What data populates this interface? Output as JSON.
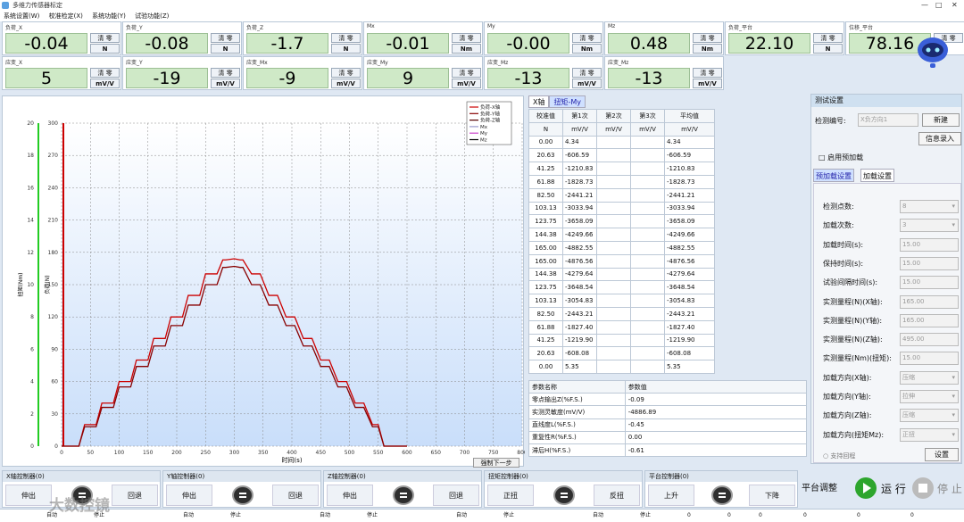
{
  "window": {
    "title": "多维力传感器标定",
    "controls": [
      "—",
      "□",
      "✕"
    ]
  },
  "menu": [
    "系统设置(W)",
    "校准检定(X)",
    "系统功能(Y)",
    "试验功能(Z)"
  ],
  "tiles": [
    {
      "label": "负荷_X",
      "value": "-0.04",
      "clear": "清 零",
      "unit": "N"
    },
    {
      "label": "负荷_Y",
      "value": "-0.08",
      "clear": "清 零",
      "unit": "N"
    },
    {
      "label": "负荷_Z",
      "value": "-1.7",
      "clear": "清 零",
      "unit": "N"
    },
    {
      "label": "Mx",
      "value": "-0.01",
      "clear": "清 零",
      "unit": "Nm"
    },
    {
      "label": "My",
      "value": "-0.00",
      "clear": "清 零",
      "unit": "Nm"
    },
    {
      "label": "Mz",
      "value": "0.48",
      "clear": "清 零",
      "unit": "Nm"
    },
    {
      "label": "负荷_平台",
      "value": "22.10",
      "clear": "清 零",
      "unit": "N"
    },
    {
      "label": "位移_平台",
      "value": "78.16",
      "clear": "清 零",
      "unit": ""
    },
    {
      "label": "应变_X",
      "value": "5",
      "clear": "清 零",
      "unit": "mV/V"
    },
    {
      "label": "应变_Y",
      "value": "-19",
      "clear": "清 零",
      "unit": "mV/V"
    },
    {
      "label": "应变_Mx",
      "value": "-9",
      "clear": "清 零",
      "unit": "mV/V"
    },
    {
      "label": "应变_My",
      "value": "9",
      "clear": "清 零",
      "unit": "mV/V"
    },
    {
      "label": "应变_Mz",
      "value": "-13",
      "clear": "清 零",
      "unit": "mV/V"
    },
    {
      "label": "应变_Mz",
      "value": "-13",
      "clear": "清 零",
      "unit": "mV/V"
    }
  ],
  "chart_data": {
    "type": "line",
    "xlabel": "时间(s)",
    "ylabel": "负荷(N)",
    "y2label": "扭矩(Nm)",
    "xlim": [
      0,
      800
    ],
    "ylim": [
      0,
      300
    ],
    "y2lim": [
      0,
      20
    ],
    "x_ticks": [
      "0",
      "50",
      "100",
      "150",
      "200",
      "250",
      "300",
      "350",
      "400",
      "450",
      "500",
      "550",
      "600",
      "650",
      "700",
      "750",
      "800"
    ],
    "y_ticks": [
      "0",
      "30",
      "60",
      "90",
      "120",
      "150",
      "180",
      "210",
      "240",
      "270",
      "300"
    ],
    "y2_ticks": [
      "0",
      "2",
      "4",
      "6",
      "8",
      "10",
      "12",
      "14",
      "16",
      "18",
      "20"
    ],
    "legend": [
      "负荷-X轴",
      "负荷-Y轴",
      "负荷-Z轴",
      "Mx",
      "My",
      "Mz"
    ],
    "legend_colors": [
      "#cc0000",
      "#880000",
      "#550000",
      "#9999cc",
      "#cc44cc",
      "#000000"
    ],
    "series": [
      {
        "name": "负荷-X轴",
        "color": "#cc0000",
        "x": [
          0,
          30,
          40,
          45,
          60,
          70,
          75,
          90,
          100,
          105,
          120,
          130,
          135,
          150,
          160,
          165,
          180,
          190,
          195,
          210,
          220,
          225,
          240,
          250,
          255,
          270,
          280,
          285,
          300,
          310,
          315,
          330,
          340,
          345,
          360,
          370,
          375,
          390,
          400,
          405,
          420,
          430,
          435,
          450,
          460,
          465,
          480,
          490,
          495,
          510,
          520,
          525,
          540,
          550,
          560,
          600
        ],
        "y": [
          0,
          0,
          20,
          20,
          20,
          40,
          40,
          40,
          60,
          60,
          60,
          80,
          80,
          80,
          100,
          100,
          100,
          120,
          120,
          120,
          140,
          140,
          140,
          160,
          160,
          160,
          173,
          173,
          174,
          173,
          173,
          160,
          160,
          160,
          140,
          140,
          140,
          120,
          120,
          120,
          100,
          100,
          100,
          80,
          80,
          80,
          60,
          60,
          60,
          40,
          40,
          40,
          20,
          20,
          0,
          0
        ]
      },
      {
        "name": "负荷-Y轴",
        "color": "#880000",
        "x": [
          0,
          30,
          40,
          45,
          60,
          70,
          75,
          90,
          100,
          105,
          120,
          130,
          135,
          150,
          160,
          165,
          180,
          190,
          195,
          210,
          220,
          225,
          240,
          250,
          255,
          270,
          280,
          285,
          300,
          310,
          315,
          330,
          340,
          345,
          360,
          370,
          375,
          390,
          400,
          405,
          420,
          430,
          435,
          450,
          460,
          465,
          480,
          490,
          495,
          510,
          520,
          525,
          540,
          550,
          560,
          600
        ],
        "y": [
          0,
          0,
          18,
          18,
          18,
          36,
          36,
          36,
          55,
          55,
          55,
          74,
          74,
          74,
          93,
          93,
          93,
          112,
          112,
          112,
          131,
          131,
          131,
          150,
          150,
          150,
          166,
          166,
          167,
          166,
          166,
          150,
          150,
          150,
          131,
          131,
          131,
          112,
          112,
          112,
          93,
          93,
          93,
          74,
          74,
          74,
          55,
          55,
          55,
          36,
          36,
          36,
          18,
          18,
          0,
          0
        ]
      }
    ],
    "button_next": "强制下一步"
  },
  "table1": {
    "tabs": [
      "X轴",
      "扭矩-My"
    ],
    "headers": [
      "校准值",
      "第1次",
      "第2次",
      "第3次",
      "平均值"
    ],
    "units": [
      "N",
      "mV/V",
      "mV/V",
      "mV/V",
      "mV/V"
    ],
    "rows": [
      [
        "0.00",
        "4.34",
        "",
        "",
        "4.34"
      ],
      [
        "20.63",
        "-606.59",
        "",
        "",
        "-606.59"
      ],
      [
        "41.25",
        "-1210.83",
        "",
        "",
        "-1210.83"
      ],
      [
        "61.88",
        "-1828.73",
        "",
        "",
        "-1828.73"
      ],
      [
        "82.50",
        "-2441.21",
        "",
        "",
        "-2441.21"
      ],
      [
        "103.13",
        "-3033.94",
        "",
        "",
        "-3033.94"
      ],
      [
        "123.75",
        "-3658.09",
        "",
        "",
        "-3658.09"
      ],
      [
        "144.38",
        "-4249.66",
        "",
        "",
        "-4249.66"
      ],
      [
        "165.00",
        "-4882.55",
        "",
        "",
        "-4882.55"
      ],
      [
        "165.00",
        "-4876.56",
        "",
        "",
        "-4876.56"
      ],
      [
        "144.38",
        "-4279.64",
        "",
        "",
        "-4279.64"
      ],
      [
        "123.75",
        "-3648.54",
        "",
        "",
        "-3648.54"
      ],
      [
        "103.13",
        "-3054.83",
        "",
        "",
        "-3054.83"
      ],
      [
        "82.50",
        "-2443.21",
        "",
        "",
        "-2443.21"
      ],
      [
        "61.88",
        "-1827.40",
        "",
        "",
        "-1827.40"
      ],
      [
        "41.25",
        "-1219.90",
        "",
        "",
        "-1219.90"
      ],
      [
        "20.63",
        "-608.08",
        "",
        "",
        "-608.08"
      ],
      [
        "0.00",
        "5.35",
        "",
        "",
        "5.35"
      ]
    ]
  },
  "table2": {
    "headers": [
      "参数名称",
      "参数值"
    ],
    "rows": [
      [
        "零点输出Z(%F.S.)",
        "-0.09"
      ],
      [
        "实测灵敏度(mV/V)",
        "-4886.89"
      ],
      [
        "直线度L(%F.S.)",
        "-0.45"
      ],
      [
        "重复性R(%F.S.)",
        "0.00"
      ],
      [
        "滞后H(%F.S.)",
        "-0.61"
      ]
    ]
  },
  "panel": {
    "title": "测试设置",
    "id_label": "检测编号:",
    "id_value": "X负方向1",
    "new_btn": "新建",
    "info_btn": "信息录入",
    "preload_check": "启用预加载",
    "tabs": [
      "预加载设置",
      "加载设置"
    ],
    "fields": [
      {
        "label": "检测点数:",
        "value": "8",
        "dd": true
      },
      {
        "label": "加载次数:",
        "value": "3",
        "dd": true
      },
      {
        "label": "加载时间(s):",
        "value": "15.00",
        "dd": false
      },
      {
        "label": "保持时间(s):",
        "value": "15.00",
        "dd": false
      },
      {
        "label": "试验间隔时间(s):",
        "value": "15.00",
        "dd": false
      },
      {
        "label": "实测量程(N)(X轴):",
        "value": "165.00",
        "dd": false
      },
      {
        "label": "实测量程(N)(Y轴):",
        "value": "165.00",
        "dd": false
      },
      {
        "label": "实测量程(N)(Z轴):",
        "value": "495.00",
        "dd": false
      },
      {
        "label": "实测量程(Nm)(扭矩):",
        "value": "15.00",
        "dd": false
      },
      {
        "label": "加载方向(X轴):",
        "value": "压缩",
        "dd": true
      },
      {
        "label": "加载方向(Y轴):",
        "value": "拉伸",
        "dd": true
      },
      {
        "label": "加载方向(Z轴):",
        "value": "压缩",
        "dd": true
      },
      {
        "label": "加载方向(扭矩Mz):",
        "value": "正扭",
        "dd": true
      }
    ],
    "support_check": "支持回程",
    "settings_btn": "设置"
  },
  "controllers": [
    {
      "title": "X轴控制器(0)",
      "left": "伸出",
      "right": "回退"
    },
    {
      "title": "Y轴控制器(0)",
      "left": "伸出",
      "right": "回退"
    },
    {
      "title": "Z轴控制器(0)",
      "left": "伸出",
      "right": "回退"
    },
    {
      "title": "扭矩控制器(0)",
      "left": "正扭",
      "right": "反扭"
    },
    {
      "title": "平台控制器(0)",
      "left": "上升",
      "right": "下降"
    }
  ],
  "platform_adjust": "平台调整",
  "run_btn": "运 行",
  "stop_btn": "停 止",
  "status": [
    "自动",
    "停止",
    "自动",
    "停止",
    "自动",
    "停止",
    "自动",
    "停止",
    "自动",
    "停止",
    "0",
    "0",
    "0",
    "0",
    "0",
    "0"
  ],
  "watermark": "大数控镜"
}
